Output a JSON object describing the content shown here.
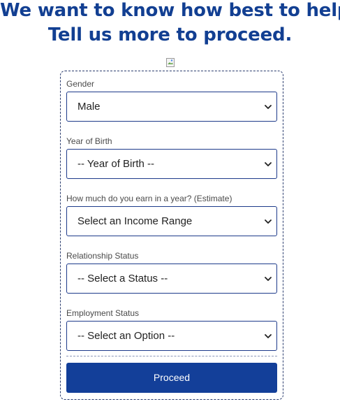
{
  "header": {
    "line1": "We want to know how best to help.",
    "line2": "Tell us more to proceed."
  },
  "image": {
    "icon": "broken-image-icon"
  },
  "form": {
    "fields": [
      {
        "label": "Gender",
        "value": "Male"
      },
      {
        "label": "Year of Birth",
        "value": "-- Year of Birth --"
      },
      {
        "label": "How much do you earn in a year? (Estimate)",
        "value": "Select an Income Range"
      },
      {
        "label": "Relationship Status",
        "value": "-- Select a Status --"
      },
      {
        "label": "Employment Status",
        "value": "-- Select an Option --"
      }
    ],
    "submit_label": "Proceed"
  },
  "colors": {
    "heading": "#123f92",
    "select_border": "#1d3a8a",
    "button_bg": "#133f99",
    "button_text": "#ffffff"
  }
}
